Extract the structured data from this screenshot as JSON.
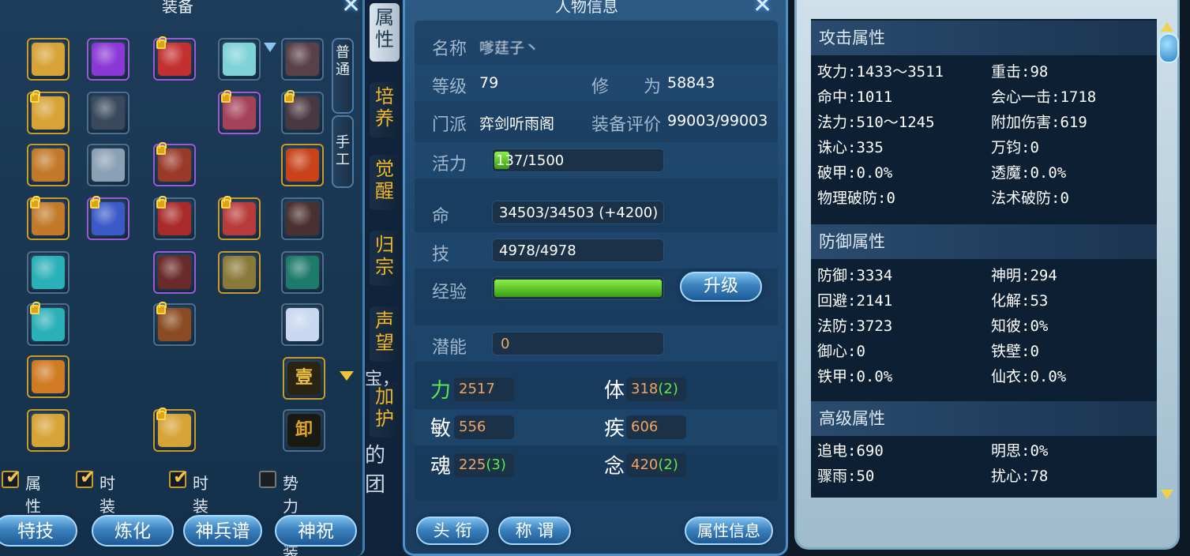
{
  "equipment_panel": {
    "title": "装备",
    "tabs": [
      "普通",
      "手工"
    ],
    "slots": [
      {
        "id": "s1",
        "c": "#d7a236",
        "locked": false,
        "frame": "gold"
      },
      {
        "id": "s2",
        "c": "#8b38d6",
        "locked": false,
        "frame": "purple"
      },
      {
        "id": "s3",
        "c": "#c23030",
        "locked": true,
        "frame": "purple"
      },
      {
        "id": "s4",
        "c": "#7fd2d8",
        "locked": false,
        "frame": "plain"
      },
      {
        "id": "s5",
        "c": "#5a4048",
        "locked": false,
        "frame": "plain"
      },
      {
        "id": "s6",
        "c": "#d7a236",
        "locked": true,
        "frame": "gold"
      },
      {
        "id": "s7",
        "c": "#3a4a5c",
        "locked": false,
        "frame": "plain"
      },
      {
        "id": "s8",
        "c": "#a3425a",
        "locked": true,
        "frame": "purple"
      },
      {
        "id": "s9",
        "c": "#4a3840",
        "locked": true,
        "frame": "plain"
      },
      {
        "id": "s10",
        "c": "#c27a2a",
        "locked": false,
        "frame": "gold"
      },
      {
        "id": "s11",
        "c": "#8aa0b4",
        "locked": false,
        "frame": "plain"
      },
      {
        "id": "s12",
        "c": "#9a3a2a",
        "locked": true,
        "frame": "purple"
      },
      {
        "id": "s13",
        "c": "#c8431a",
        "locked": false,
        "frame": "gold"
      },
      {
        "id": "s14",
        "c": "#c27a2a",
        "locked": true,
        "frame": "gold"
      },
      {
        "id": "s15",
        "c": "#3a5ac8",
        "locked": true,
        "frame": "purple"
      },
      {
        "id": "s16",
        "c": "#a82a2a",
        "locked": true,
        "frame": "plain"
      },
      {
        "id": "s17",
        "c": "#b83a3a",
        "locked": true,
        "frame": "gold"
      },
      {
        "id": "s18",
        "c": "#4a3030",
        "locked": false,
        "frame": "plain"
      },
      {
        "id": "s19",
        "c": "#2ab0b8",
        "locked": false,
        "frame": "plain"
      },
      {
        "id": "s20",
        "c": "#6a2a2a",
        "locked": false,
        "frame": "purple"
      },
      {
        "id": "s21",
        "c": "#8a7a3a",
        "locked": false,
        "frame": "gold"
      },
      {
        "id": "s22",
        "c": "#1e7a6a",
        "locked": false,
        "frame": "plain"
      },
      {
        "id": "s23",
        "c": "#2ab0b8",
        "locked": true,
        "frame": "plain"
      },
      {
        "id": "s24",
        "c": "#8a4a22",
        "locked": true,
        "frame": "plain"
      },
      {
        "id": "s25",
        "c": "#c8d8f0",
        "locked": false,
        "frame": "plain"
      },
      {
        "id": "s26",
        "c": "#d07a22",
        "locked": false,
        "frame": "gold"
      },
      {
        "id": "s27",
        "c": "#d7a236",
        "locked": false,
        "frame": "gold"
      },
      {
        "id": "s28",
        "c": "#d7a236",
        "locked": true,
        "frame": "gold"
      },
      {
        "id": "s29",
        "c": "#b02a3a",
        "locked": true,
        "frame": "purple"
      },
      {
        "id": "s30",
        "c": "#d7a236",
        "locked": false,
        "frame": "gold"
      }
    ],
    "seal_labels": [
      "壹",
      "卸"
    ],
    "checkboxes": [
      {
        "label": "属性",
        "checked": true
      },
      {
        "label": "时装帽",
        "checked": true
      },
      {
        "label": "时装衣",
        "checked": true
      },
      {
        "label": "势力时装",
        "checked": false
      }
    ],
    "buttons": [
      "特技",
      "炼化",
      "神兵谱",
      "神祝"
    ]
  },
  "side_tabs": [
    "属性",
    "培养",
    "觉醒",
    "归宗",
    "声望",
    "加护"
  ],
  "background_text": [
    "宝，",
    "的团"
  ],
  "character": {
    "title": "人物信息",
    "name_label": "名称",
    "name_value": "嗲莛子丶",
    "level_label": "等级",
    "level_value": "79",
    "cultivation_label": "修　　为",
    "cultivation_value": "58843",
    "faction_label": "门派",
    "faction_value": "弈剑听雨阁",
    "gear_score_label": "装备评价",
    "gear_score_value": "99003/99003",
    "vitality_label": "活力",
    "vitality_value": "137/1500",
    "vitality_fraction": 0.091,
    "hp_label": "命",
    "hp_value": "34503/34503 (+4200)",
    "mp_label": "技",
    "mp_value": "4978/4978",
    "exp_label": "经验",
    "exp_fraction": 1.0,
    "levelup_button": "升级",
    "potential_label": "潜能",
    "potential_value": "0",
    "stats": [
      {
        "label": "力",
        "value": "2517",
        "bonus": ""
      },
      {
        "label": "体",
        "value": "318",
        "bonus": "(2)"
      },
      {
        "label": "敏",
        "value": "556",
        "bonus": ""
      },
      {
        "label": "疾",
        "value": "606",
        "bonus": ""
      },
      {
        "label": "魂",
        "value": "225",
        "bonus": "(3)"
      },
      {
        "label": "念",
        "value": "420",
        "bonus": "(2)"
      }
    ],
    "buttons": [
      "头 衔",
      "称 谓",
      "属性信息"
    ]
  },
  "attributes": {
    "attack_title": "攻击属性",
    "attack": [
      [
        "攻力:1433～3511",
        "重击:98"
      ],
      [
        "命中:1011",
        "会心一击:1718"
      ],
      [
        "法力:510～1245",
        "附加伤害:619"
      ],
      [
        "诛心:335",
        "万钧:0"
      ],
      [
        "破甲:0.0%",
        "透魔:0.0%"
      ],
      [
        "物理破防:0",
        "法术破防:0"
      ]
    ],
    "defense_title": "防御属性",
    "defense": [
      [
        "防御:3334",
        "神明:294"
      ],
      [
        "回避:2141",
        "化解:53"
      ],
      [
        "法防:3723",
        "知彼:0%"
      ],
      [
        "御心:0",
        "铁壁:0"
      ],
      [
        "铁甲:0.0%",
        "仙衣:0.0%"
      ]
    ],
    "advanced_title": "高级属性",
    "advanced": [
      [
        "追电:690",
        "明思:0%"
      ],
      [
        "骤雨:50",
        "扰心:78"
      ]
    ]
  }
}
